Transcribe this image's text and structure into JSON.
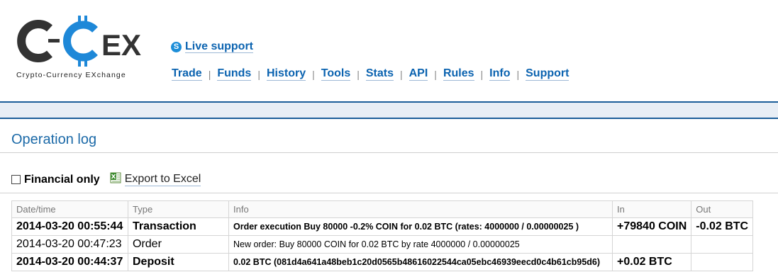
{
  "header": {
    "logo": {
      "letters": [
        "C",
        "C",
        "EX"
      ],
      "subtitle": "Crypto-Currency EXchange"
    },
    "live_support": {
      "icon": "skype-icon",
      "label": "Live support"
    },
    "nav": [
      {
        "label": "Trade"
      },
      {
        "label": "Funds"
      },
      {
        "label": "History"
      },
      {
        "label": "Tools"
      },
      {
        "label": "Stats"
      },
      {
        "label": "API"
      },
      {
        "label": "Rules"
      },
      {
        "label": "Info"
      },
      {
        "label": "Support"
      }
    ],
    "nav_separator": "|"
  },
  "page": {
    "title": "Operation log",
    "filter_label": "Financial only",
    "filter_checked": false,
    "export_icon": "excel-icon",
    "export_label": "Export to Excel"
  },
  "table": {
    "columns": [
      "Date/time",
      "Type",
      "Info",
      "In",
      "Out"
    ],
    "rows": [
      {
        "bold": true,
        "datetime": "2014-03-20 00:55:44",
        "type": "Transaction",
        "info": "Order execution Buy 80000 -0.2% COIN for 0.02 BTC (rates: 4000000 / 0.00000025 )",
        "in": "+79840 COIN",
        "out": "-0.02 BTC"
      },
      {
        "bold": false,
        "datetime": "2014-03-20 00:47:23",
        "type": "Order",
        "info": "New order: Buy 80000 COIN for 0.02 BTC by rate 4000000 / 0.00000025",
        "in": "",
        "out": ""
      },
      {
        "bold": true,
        "datetime": "2014-03-20 00:44:37",
        "type": "Deposit",
        "info": "0.02 BTC (081d4a641a48beb1c20d0565b48616022544ca05ebc46939eecd0c4b61cb95d6)",
        "in": "+0.02 BTC",
        "out": ""
      }
    ]
  },
  "colors": {
    "link": "#0b63b0",
    "title": "#1c6aa8",
    "bar_border": "#1c5e99",
    "bar_fill": "#e8eef5",
    "logo_dark": "#333333",
    "logo_blue": "#1e88d8"
  }
}
